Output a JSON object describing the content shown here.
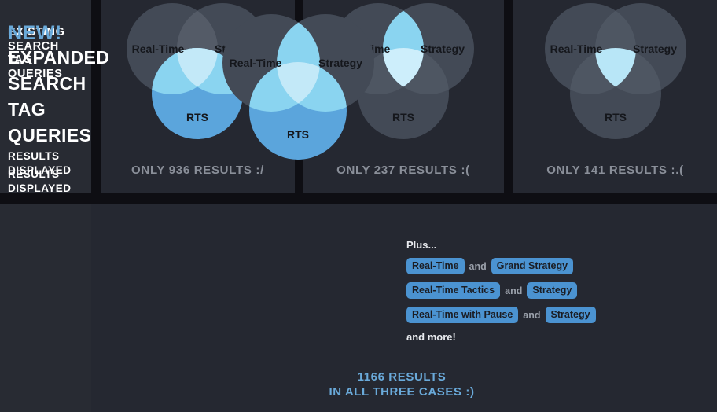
{
  "colors": {
    "page_bg": "#0e0e13",
    "column_bg": "#282b33",
    "panel_bg": "#252831",
    "circle_gray": "#434a56",
    "blue_solid": "#5ba5dc",
    "blue_light": "#8ad4f0",
    "blue_lighter": "#b8e6f7",
    "accent_blue": "#6aaada",
    "caption_gray": "#8a8f99",
    "tag_bg": "#4b93d1",
    "tag_text": "#1b1d23",
    "heading_white": "#ffffff"
  },
  "top": {
    "row_label_queries": "EXISTING\nSEARCH\nTAG\nQUERIES",
    "row_label_queries_lines": [
      "EXISTING",
      "SEARCH",
      "TAG",
      "QUERIES"
    ],
    "row_label_results": "RESULTS\nDISPLAYED",
    "row_label_results_lines": [
      "RESULTS",
      "DISPLAYED"
    ],
    "panels": [
      {
        "id": "panel-1",
        "venn": {
          "circles": [
            {
              "name": "Real-Time",
              "label": "Real-Time"
            },
            {
              "name": "Strategy",
              "label": "Strategy"
            },
            {
              "name": "RTS",
              "label": "RTS"
            }
          ],
          "highlight": "rts-circle-full"
        },
        "caption": "ONLY 936 RESULTS :/",
        "result_count": 936
      },
      {
        "id": "panel-2",
        "venn": {
          "circles": [
            {
              "name": "Real-Time",
              "label": "Real-Time"
            },
            {
              "name": "Strategy",
              "label": "Strategy"
            },
            {
              "name": "RTS",
              "label": "RTS"
            }
          ],
          "highlight": "realtime-strategy-lens"
        },
        "caption": "ONLY 237 RESULTS :(",
        "result_count": 237
      },
      {
        "id": "panel-3",
        "venn": {
          "circles": [
            {
              "name": "Real-Time",
              "label": "Real-Time"
            },
            {
              "name": "Strategy",
              "label": "Strategy"
            },
            {
              "name": "RTS",
              "label": "RTS"
            }
          ],
          "highlight": "triple-intersection"
        },
        "caption": "ONLY 141 RESULTS :.(",
        "result_count": 141
      }
    ]
  },
  "bottom": {
    "new_label": "NEW!",
    "heading_lines": [
      "EXPANDED",
      "SEARCH",
      "TAG",
      "QUERIES"
    ],
    "row_label_results_lines": [
      "RESULTS",
      "DISPLAYED"
    ],
    "venn": {
      "circles": [
        {
          "name": "Real-Time",
          "label": "Real-Time"
        },
        {
          "name": "Strategy",
          "label": "Strategy"
        },
        {
          "name": "RTS",
          "label": "RTS"
        }
      ],
      "highlight": "rts-circle-full-plus-lens"
    },
    "caption_line1": "1166 RESULTS",
    "caption_line2": "IN ALL THREE CASES :)",
    "result_count": 1166,
    "tags": {
      "plus_label": "Plus...",
      "and_word": "and",
      "rows": [
        {
          "left": "Real-Time",
          "connector": "and",
          "right": "Grand Strategy"
        },
        {
          "left": "Real-Time Tactics",
          "connector": "and",
          "right": "Strategy"
        },
        {
          "left": "Real-Time with Pause",
          "connector": "and",
          "right": "Strategy"
        }
      ],
      "footer": "and more!"
    }
  }
}
